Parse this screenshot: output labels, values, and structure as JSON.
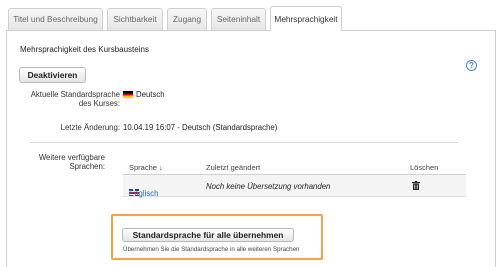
{
  "tabs": [
    {
      "label": "Titel und Beschreibung"
    },
    {
      "label": "Sichtbarkeit"
    },
    {
      "label": "Zugang"
    },
    {
      "label": "Seiteninhalt"
    },
    {
      "label": "Mehrsprachigkeit"
    }
  ],
  "section": {
    "title": "Mehrsprachigkeit des Kursbausteins",
    "help_icon": "help-icon",
    "deactivate_label": "Deaktivieren"
  },
  "current_language": {
    "label": "Aktuelle Standardsprache des Kurses:",
    "value": "Deutsch",
    "flag": "flag-de"
  },
  "last_change": {
    "label": "Letzte Änderung:",
    "value": "10.04.19 16:07 - Deutsch (Standardsprache)"
  },
  "other_languages": {
    "label": "Weitere verfügbare Sprachen:",
    "columns": {
      "language": "Sprache ↓",
      "last_changed": "Zuletzt geändert",
      "delete": "Löschen"
    },
    "rows": [
      {
        "language": "Englisch",
        "flag": "flag-uk",
        "last_changed": "Noch keine Übersetzung vorhanden",
        "delete_icon": "trash-icon"
      }
    ]
  },
  "apply_all": {
    "button_label": "Standardsprache für alle übernehmen",
    "hint": "Übernehmen Sie die Standardsprache in alle weiteren Sprachen"
  },
  "colors": {
    "highlight": "#f4a24a",
    "link": "#2b6cb0",
    "help": "#4a86c5"
  }
}
